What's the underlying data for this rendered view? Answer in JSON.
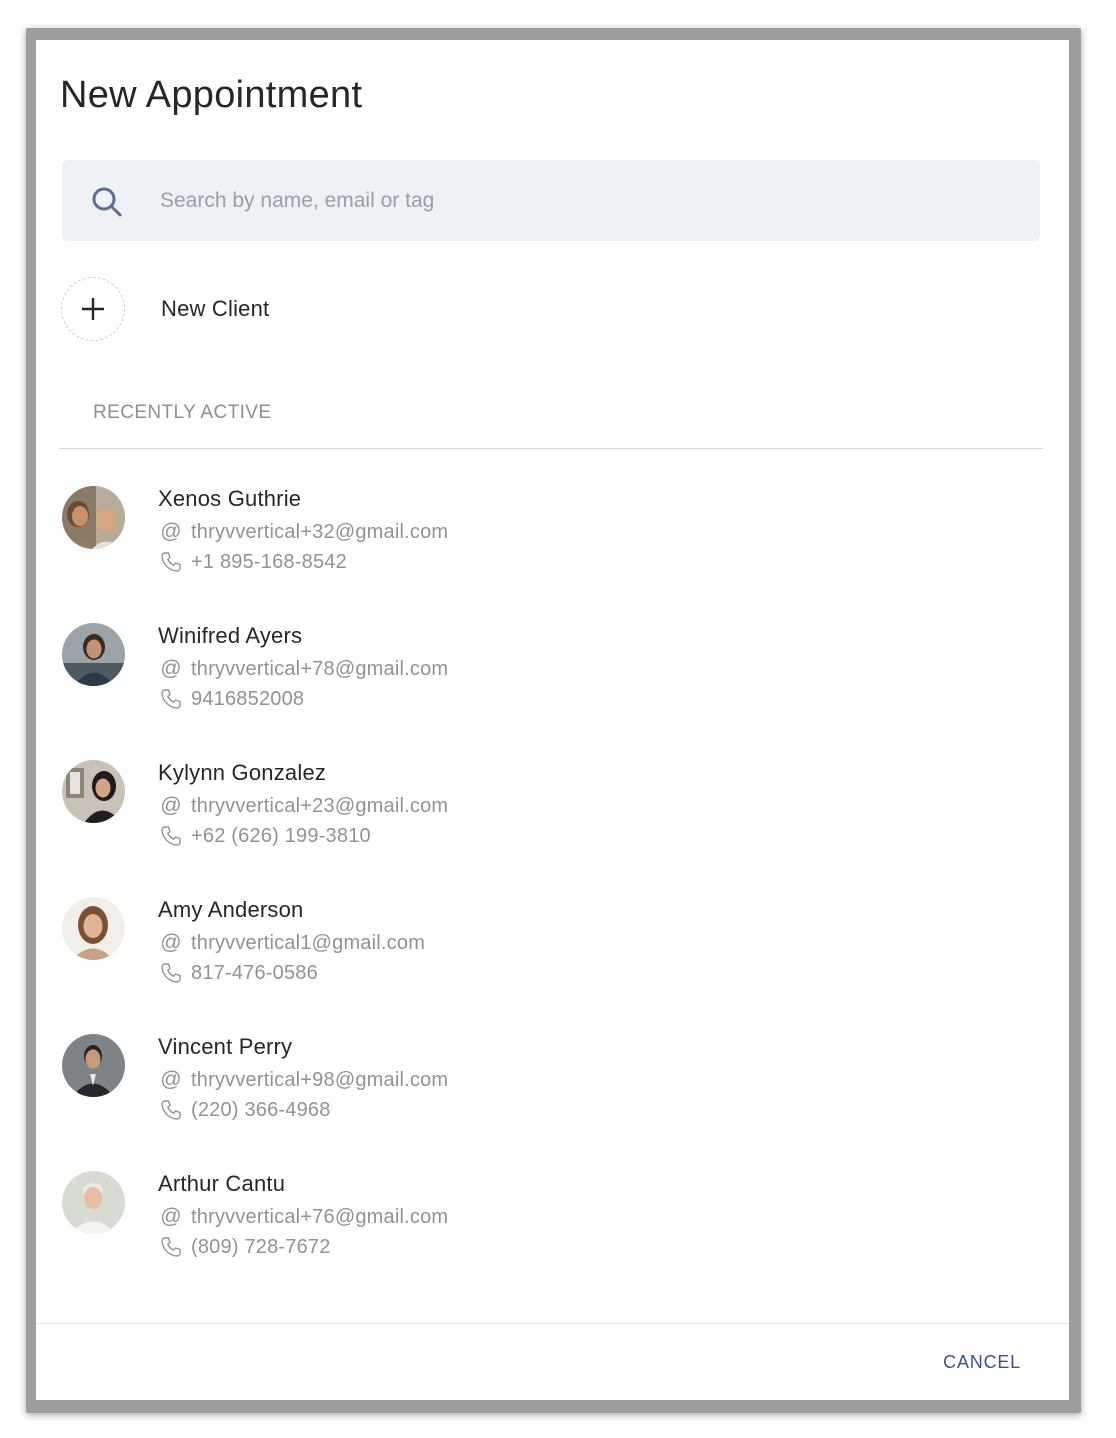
{
  "dialog": {
    "title": "New Appointment"
  },
  "search": {
    "placeholder": "Search by name, email or tag",
    "icon": "search-icon"
  },
  "new_client": {
    "label": "New Client",
    "icon": "plus-icon"
  },
  "recent": {
    "section_label": "RECENTLY ACTIVE",
    "clients": [
      {
        "name": "Xenos Guthrie",
        "email": "thryvvertical+32@gmail.com",
        "phone": "+1 895-168-8542"
      },
      {
        "name": "Winifred Ayers",
        "email": "thryvvertical+78@gmail.com",
        "phone": "9416852008"
      },
      {
        "name": "Kylynn Gonzalez",
        "email": "thryvvertical+23@gmail.com",
        "phone": "+62 (626) 199-3810"
      },
      {
        "name": "Amy Anderson",
        "email": "thryvvertical1@gmail.com",
        "phone": "817-476-0586"
      },
      {
        "name": "Vincent Perry",
        "email": "thryvvertical+98@gmail.com",
        "phone": "(220) 366-4968"
      },
      {
        "name": "Arthur Cantu",
        "email": "thryvvertical+76@gmail.com",
        "phone": "(809) 728-7672"
      }
    ]
  },
  "labels": {
    "email_symbol": "@"
  },
  "footer": {
    "cancel_label": "CANCEL"
  },
  "colors": {
    "accent": "#3d4f8f",
    "search_bg": "#eef1f5",
    "muted_text": "#8e939a"
  }
}
